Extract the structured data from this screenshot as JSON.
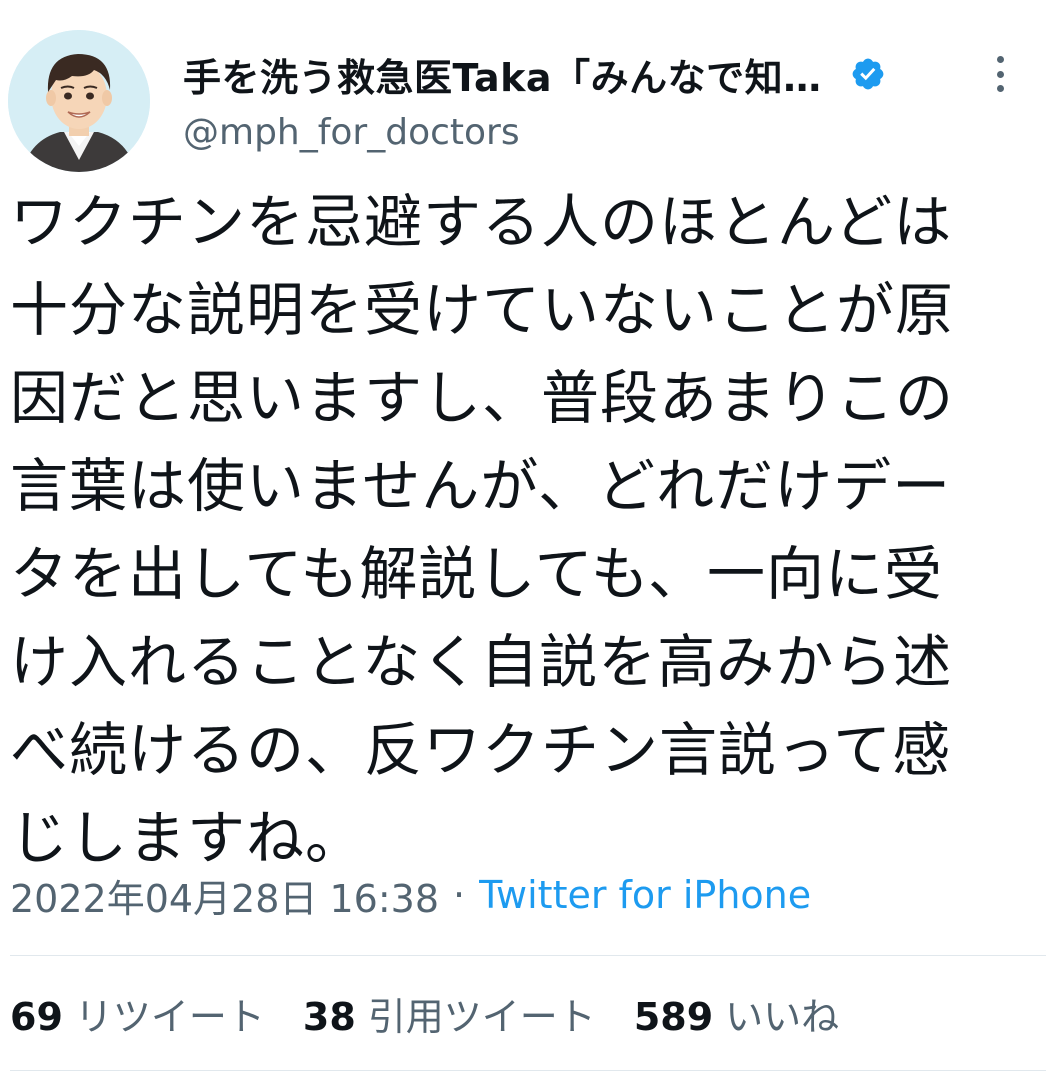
{
  "author": {
    "display_name": "手を洗う救急医Taka「みんなで知…",
    "handle": "@mph_for_doctors",
    "verified_icon": "verified-badge-icon",
    "more_icon": "more-vertical-icon"
  },
  "tweet": {
    "text": "ワクチンを忌避する人のほとんどは\n十分な説明を受けていないことが原\n因だと思いますし、普段あまりこの\n言葉は使いませんが、どれだけデー\nタを出しても解説しても、一向に受\nけ入れることなく自説を高みから述\nべ続けるの、反ワクチン言説って感\nじしますね。",
    "timestamp": "2022年04月28日 16:38",
    "separator": "·",
    "source": "Twitter for iPhone"
  },
  "stats": {
    "retweets": {
      "count": "69",
      "label": "リツイート"
    },
    "quotes": {
      "count": "38",
      "label": "引用ツイート"
    },
    "likes": {
      "count": "589",
      "label": "いいね"
    }
  },
  "colors": {
    "text": "#0f1419",
    "secondary": "#536471",
    "link": "#1d9bf0",
    "divider": "#e1e8ed"
  }
}
